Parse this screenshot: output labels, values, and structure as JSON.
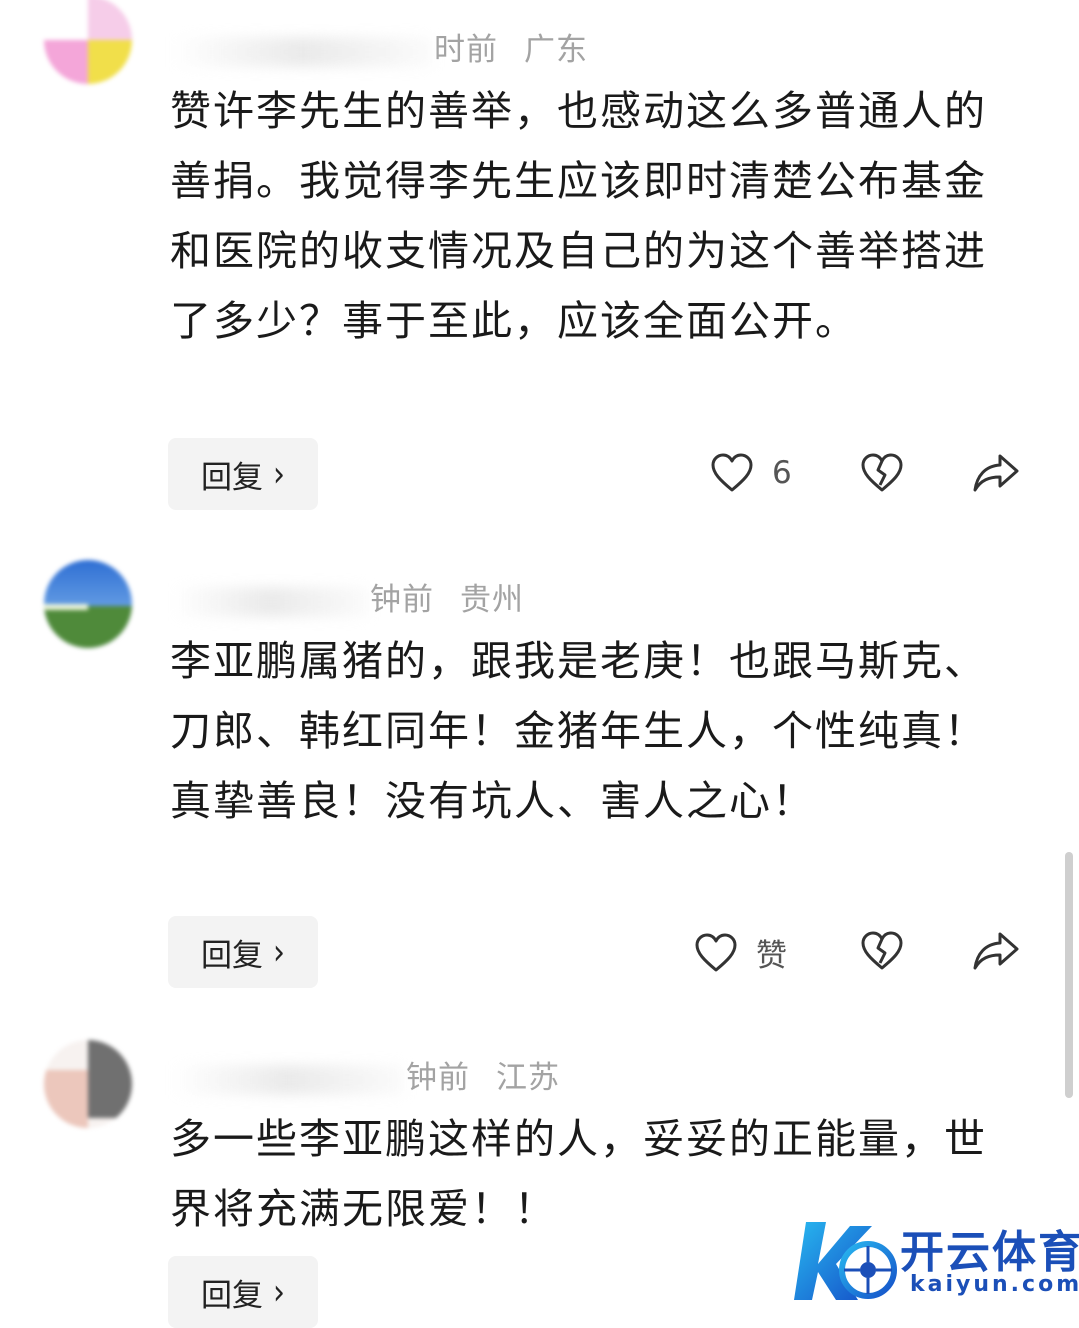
{
  "comments": [
    {
      "time": "时前",
      "location": "广东",
      "text": "赞许李先生的善举，也感动这么多普通人的善捐。我觉得李先生应该即时清楚公布基金和医院的收支情况及自己的为这个善举搭进了多少？事于至此，应该全面公开。",
      "reply_label": "回复",
      "like_label": "6"
    },
    {
      "time": "钟前",
      "location": "贵州",
      "text": "李亚鹏属猪的，跟我是老庚！也跟马斯克、刀郎、韩红同年！金猪年生人，个性纯真！真挚善良！没有坑人、害人之心！",
      "reply_label": "回复",
      "like_label": "赞"
    },
    {
      "time": "钟前",
      "location": "江苏",
      "text": "多一些李亚鹏这样的人，妥妥的正能量，世界将充满无限爱！！",
      "reply_label": "回复"
    }
  ],
  "watermark": {
    "title": "开云体育",
    "domain": "kaiyun.com"
  },
  "colors": {
    "meta_text": "#a3a3a3",
    "body_text": "#1a1a1a",
    "reply_bg": "#f3f3f3",
    "icon_stroke": "#333333",
    "watermark_blue": "#1b4fb8"
  },
  "icons": [
    "heart-icon",
    "broken-heart-icon",
    "share-icon",
    "chevron-right-icon"
  ]
}
